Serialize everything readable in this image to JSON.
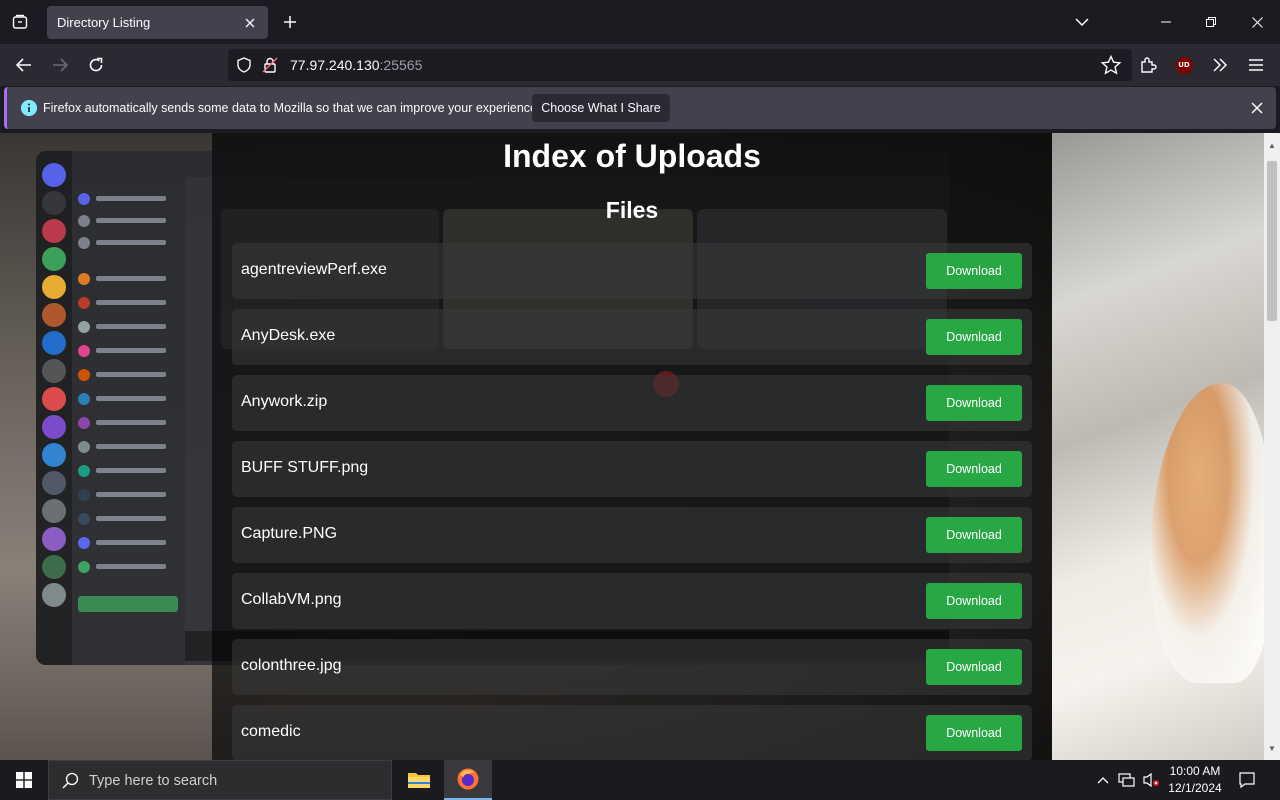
{
  "browser": {
    "tab_title": "Directory Listing",
    "url_host": "77.97.240.130",
    "url_port": ":25565",
    "extension_badge": "UD",
    "notification": {
      "text": "Firefox automatically sends some data to Mozilla so that we can improve your experience.",
      "button_label": "Choose What I Share"
    }
  },
  "page": {
    "title": "Index of Uploads",
    "section_heading": "Files",
    "files": [
      {
        "name": "agentreviewPerf.exe",
        "action": "Download"
      },
      {
        "name": "AnyDesk.exe",
        "action": "Download"
      },
      {
        "name": "Anywork.zip",
        "action": "Download"
      },
      {
        "name": "BUFF STUFF.png",
        "action": "Download"
      },
      {
        "name": "Capture.PNG",
        "action": "Download"
      },
      {
        "name": "CollabVM.png",
        "action": "Download"
      },
      {
        "name": "colonthree.jpg",
        "action": "Download"
      },
      {
        "name": "comedic",
        "action": "Download"
      }
    ]
  },
  "taskbar": {
    "search_placeholder": "Type here to search",
    "time": "10:00 AM",
    "date": "12/1/2024"
  },
  "colors": {
    "download_button": "#28a745",
    "tab_active": "#42414d",
    "notification_accent": "#a66efd"
  }
}
